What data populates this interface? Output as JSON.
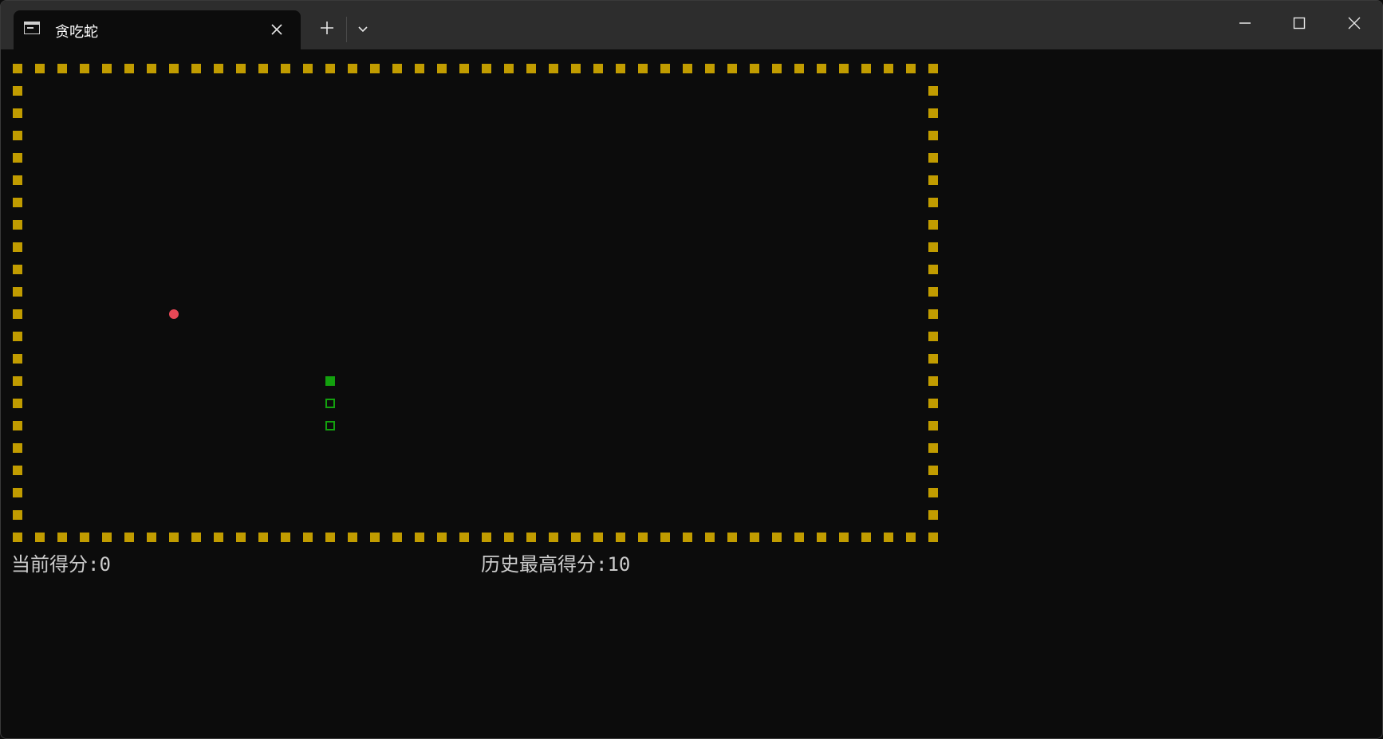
{
  "window": {
    "tab_title": "贪吃蛇",
    "icons": {
      "tab": "terminal-icon",
      "tab_close": "close-icon",
      "new_tab": "plus-icon",
      "dropdown": "chevron-down-icon",
      "minimize": "minimize-icon",
      "maximize": "maximize-icon",
      "close": "close-icon"
    }
  },
  "game": {
    "board": {
      "columns": 42,
      "rows": 22
    },
    "snake": {
      "head": [
        14,
        14
      ],
      "body": [
        [
          14,
          15
        ],
        [
          14,
          16
        ]
      ]
    },
    "food": [
      7,
      11
    ],
    "current_score": "当前得分:0",
    "high_score": "历史最高得分:10"
  },
  "colors": {
    "background": "#0c0c0c",
    "wall": "#c19c00",
    "snake": "#13a10e",
    "food": "#e74856",
    "text": "#cccccc"
  }
}
